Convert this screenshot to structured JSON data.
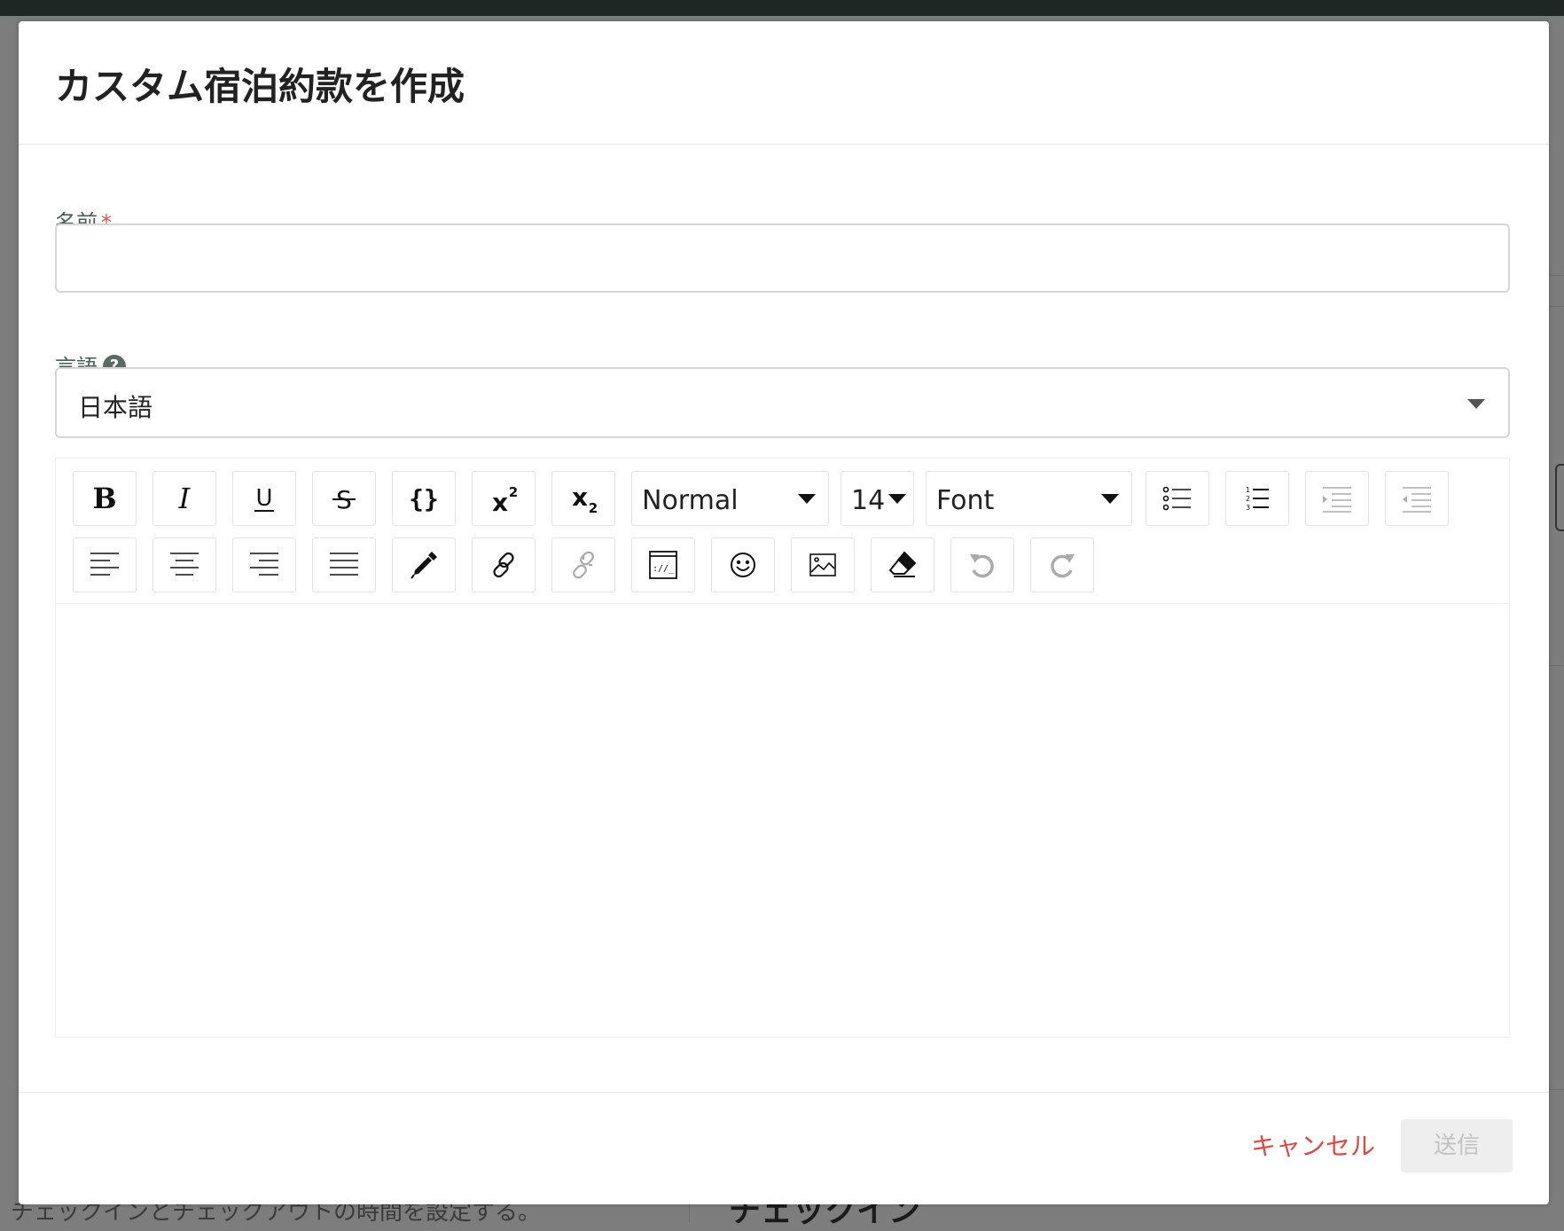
{
  "modal": {
    "title": "カスタム宿泊約款を作成",
    "name_field": {
      "label": "名前",
      "required_mark": "*",
      "value": ""
    },
    "language_field": {
      "label": "言語",
      "help_icon": "?",
      "selected": "日本語"
    },
    "toolbar": {
      "row1": [
        {
          "type": "button",
          "icon": "bold-icon"
        },
        {
          "type": "button",
          "icon": "italic-icon"
        },
        {
          "type": "button",
          "icon": "underline-icon"
        },
        {
          "type": "button",
          "icon": "strikethrough-icon"
        },
        {
          "type": "button",
          "icon": "code-braces-icon"
        },
        {
          "type": "button",
          "icon": "superscript-icon"
        },
        {
          "type": "button",
          "icon": "subscript-icon"
        },
        {
          "type": "dropdown",
          "name": "block-type",
          "value": "Normal"
        },
        {
          "type": "dropdown",
          "name": "font-size",
          "value": "14"
        },
        {
          "type": "dropdown",
          "name": "font-family",
          "value": "Font"
        },
        {
          "type": "button",
          "icon": "bulleted-list-icon"
        },
        {
          "type": "button",
          "icon": "numbered-list-icon"
        },
        {
          "type": "button",
          "icon": "indent-icon",
          "disabled": true
        },
        {
          "type": "button",
          "icon": "outdent-icon",
          "disabled": true
        }
      ],
      "row2": [
        {
          "type": "button",
          "icon": "align-left-icon"
        },
        {
          "type": "button",
          "icon": "align-center-icon"
        },
        {
          "type": "button",
          "icon": "align-right-icon"
        },
        {
          "type": "button",
          "icon": "align-justify-icon"
        },
        {
          "type": "button",
          "icon": "color-picker-icon"
        },
        {
          "type": "button",
          "icon": "link-icon"
        },
        {
          "type": "button",
          "icon": "unlink-icon",
          "disabled": true
        },
        {
          "type": "button",
          "icon": "embed-icon"
        },
        {
          "type": "button",
          "icon": "emoji-icon"
        },
        {
          "type": "button",
          "icon": "image-icon"
        },
        {
          "type": "button",
          "icon": "eraser-icon"
        },
        {
          "type": "button",
          "icon": "undo-icon",
          "disabled": true
        },
        {
          "type": "button",
          "icon": "redo-icon",
          "disabled": true
        }
      ]
    },
    "footer": {
      "cancel_label": "キャンセル",
      "submit_label": "送信",
      "submit_disabled": true
    }
  },
  "background": {
    "bottom_text": "チェックインとチェックアウトの時間を設定する。",
    "bottom_heading": "チェックイン"
  }
}
